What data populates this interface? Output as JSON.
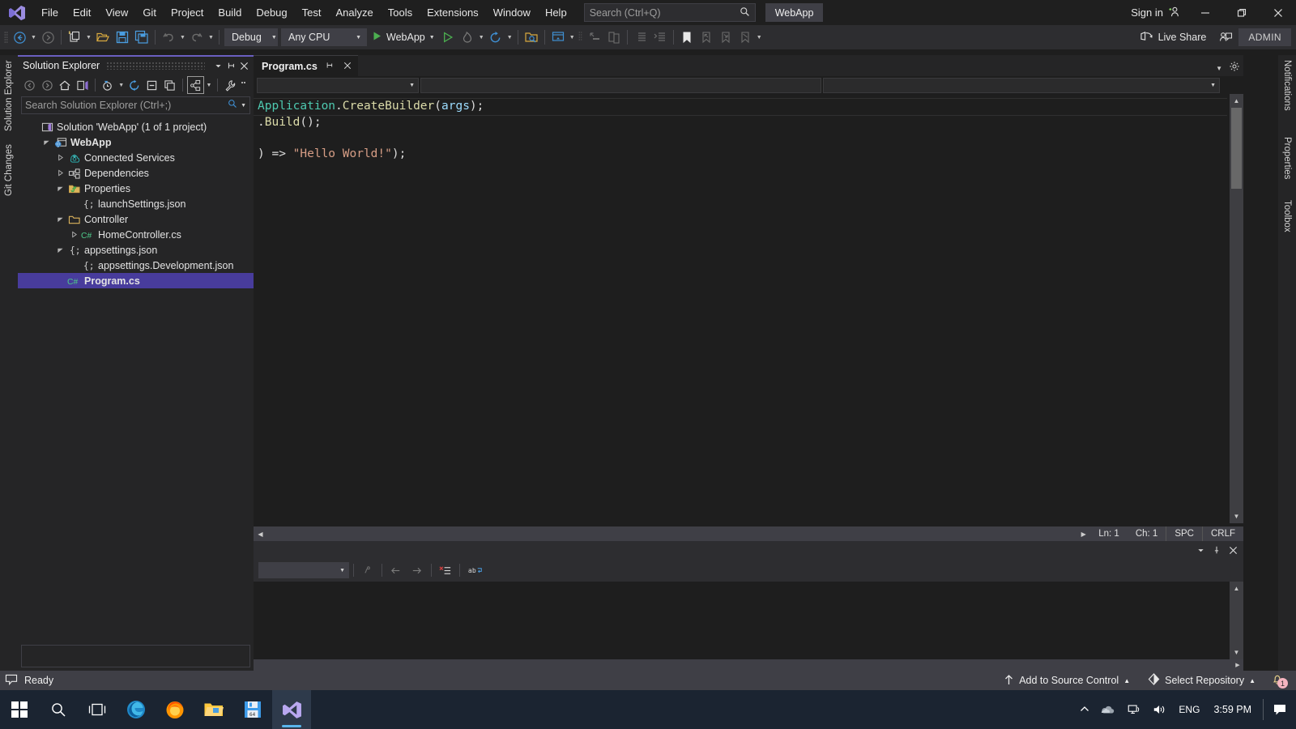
{
  "menubar": {
    "logo_icon": "visual-studio-logo",
    "items": [
      "File",
      "Edit",
      "View",
      "Git",
      "Project",
      "Build",
      "Debug",
      "Test",
      "Analyze",
      "Tools",
      "Extensions",
      "Window",
      "Help"
    ],
    "search_placeholder": "Search (Ctrl+Q)",
    "search_icon": "search-icon",
    "project_chip": "WebApp",
    "sign_in": "Sign in",
    "sign_in_icon": "add-account-icon",
    "minimize_icon": "minimize-icon",
    "maximize_icon": "restore-icon",
    "close_icon": "close-icon"
  },
  "toolbar": {
    "back_icon": "navigate-back-icon",
    "forward_icon": "navigate-forward-icon",
    "new_project_icon": "new-project-icon",
    "open_file_icon": "open-file-icon",
    "save_icon": "save-icon",
    "save_all_icon": "save-all-icon",
    "undo_icon": "undo-icon",
    "redo_icon": "redo-icon",
    "config_value": "Debug",
    "platform_value": "Any CPU",
    "run_label": "WebApp",
    "run_icon": "run-play-icon",
    "run_no_debug_icon": "start-without-debugging-icon",
    "hot_reload_icon": "hot-reload-icon",
    "restart_icon": "restart-icon",
    "find_in_files_icon": "find-in-files-icon",
    "window_layout_icon": "window-layout-icon",
    "step_icon": "step-into-icon",
    "compare_icon": "compare-files-icon",
    "indent_icon": "decrease-indent-icon",
    "outdent_icon": "increase-indent-icon",
    "bookmark_icon": "bookmark-icon",
    "prev_bookmark_icon": "previous-bookmark-icon",
    "next_bookmark_icon": "next-bookmark-icon",
    "clear_bookmark_icon": "clear-bookmarks-icon",
    "overflow_icon": "toolbar-overflow-icon",
    "live_share": "Live Share",
    "live_share_icon": "live-share-icon",
    "feedback_icon": "send-feedback-icon",
    "admin_badge": "ADMIN"
  },
  "left_dock": {
    "tabs": [
      "Solution Explorer",
      "Git Changes"
    ]
  },
  "right_dock": {
    "tabs": [
      "Notifications",
      "Properties",
      "Toolbox"
    ]
  },
  "solution_explorer": {
    "title": "Solution Explorer",
    "header_caret_icon": "chevron-down-icon",
    "header_pin_icon": "pin-icon",
    "header_close_icon": "close-icon",
    "toolbar_icons": [
      "back-icon",
      "forward-icon",
      "home-icon",
      "sync-with-active-document-icon",
      "pending-changes-filter-icon",
      "refresh-icon",
      "collapse-all-icon",
      "show-all-files-icon",
      "view-class-diagram-icon",
      "properties-wrench-icon",
      "overflow-icon"
    ],
    "search_placeholder": "Search Solution Explorer (Ctrl+;)",
    "search_icon": "search-icon",
    "tree": [
      {
        "label": "Solution 'WebApp' (1 of 1 project)",
        "icon": "solution-icon",
        "indent": 0,
        "twist": "none",
        "bold": false,
        "selected": false
      },
      {
        "label": "WebApp",
        "icon": "web-project-icon",
        "indent": 1,
        "twist": "open",
        "bold": true,
        "selected": false
      },
      {
        "label": "Connected Services",
        "icon": "connected-services-icon",
        "indent": 2,
        "twist": "closed",
        "bold": false,
        "selected": false
      },
      {
        "label": "Dependencies",
        "icon": "dependencies-icon",
        "indent": 2,
        "twist": "closed",
        "bold": false,
        "selected": false
      },
      {
        "label": "Properties",
        "icon": "properties-folder-icon",
        "indent": 2,
        "twist": "open",
        "bold": false,
        "selected": false
      },
      {
        "label": "launchSettings.json",
        "icon": "json-file-icon",
        "indent": 3,
        "twist": "none",
        "bold": false,
        "selected": false
      },
      {
        "label": "Controller",
        "icon": "folder-icon",
        "indent": 2,
        "twist": "open",
        "bold": false,
        "selected": false
      },
      {
        "label": "HomeController.cs",
        "icon": "csharp-file-icon",
        "indent": 3,
        "twist": "closed",
        "bold": false,
        "selected": false
      },
      {
        "label": "appsettings.json",
        "icon": "json-file-icon",
        "indent": 2,
        "twist": "open",
        "bold": false,
        "selected": false
      },
      {
        "label": "appsettings.Development.json",
        "icon": "json-file-icon",
        "indent": 3,
        "twist": "none",
        "bold": false,
        "selected": false
      },
      {
        "label": "Program.cs",
        "icon": "csharp-file-icon",
        "indent": 2,
        "twist": "none",
        "bold": true,
        "selected": true
      }
    ]
  },
  "editor": {
    "tab_label": "Program.cs",
    "tab_pin_icon": "pin-icon",
    "tab_close_icon": "close-icon",
    "tabstrip_caret_icon": "chevron-down-icon",
    "tabstrip_settings_icon": "gear-icon",
    "split_icon": "split-window-icon",
    "nav_type_caret": "chevron-down-icon",
    "code_lines": [
      [
        {
          "t": "Application",
          "c": "type"
        },
        {
          "t": ".",
          "c": "punct"
        },
        {
          "t": "CreateBuilder",
          "c": "method"
        },
        {
          "t": "(",
          "c": "punct"
        },
        {
          "t": "args",
          "c": "param"
        },
        {
          "t": ");",
          "c": "punct"
        }
      ],
      [
        {
          "t": ".",
          "c": "punct"
        },
        {
          "t": "Build",
          "c": "method"
        },
        {
          "t": "();",
          "c": "punct"
        }
      ],
      [],
      [
        {
          "t": ") => ",
          "c": "punct"
        },
        {
          "t": "\"Hello World!\"",
          "c": "str"
        },
        {
          "t": ");",
          "c": "punct"
        }
      ]
    ],
    "status": {
      "line": "Ln: 1",
      "char": "Ch: 1",
      "spaces": "SPC",
      "eol": "CRLF"
    }
  },
  "tool_window": {
    "caret_icon": "chevron-down-icon",
    "pin_icon": "pin-icon",
    "close_icon": "close-icon",
    "combo_value": "",
    "combo_caret_icon": "chevron-down-icon",
    "toolbar_icons": [
      "find-message-icon",
      "go-to-previous-icon",
      "go-to-next-icon",
      "clear-all-icon",
      "toggle-word-wrap-icon"
    ]
  },
  "statusbar": {
    "ready_icon": "ready-flag-icon",
    "ready_text": "Ready",
    "add_to_source_control": "Add to Source Control",
    "add_to_source_control_icon": "upload-arrow-icon",
    "add_caret_icon": "chevron-up-icon",
    "select_repository": "Select Repository",
    "select_repository_icon": "repository-icon",
    "repo_caret_icon": "chevron-up-icon",
    "notification_icon": "bell-icon",
    "notification_count": "1"
  },
  "taskbar": {
    "items": [
      {
        "name": "start-button",
        "icon": "windows-logo-icon",
        "active": false,
        "running": false
      },
      {
        "name": "search-button",
        "icon": "search-icon",
        "active": false,
        "running": false
      },
      {
        "name": "task-view-button",
        "icon": "task-view-icon",
        "active": false,
        "running": false
      },
      {
        "name": "edge-button",
        "icon": "microsoft-edge-icon",
        "active": false,
        "running": false
      },
      {
        "name": "firefox-button",
        "icon": "firefox-icon",
        "active": false,
        "running": true
      },
      {
        "name": "file-explorer-button",
        "icon": "file-explorer-icon",
        "active": false,
        "running": true
      },
      {
        "name": "dosbox-button",
        "icon": "floppy-disk-icon",
        "active": false,
        "running": true
      },
      {
        "name": "visual-studio-button",
        "icon": "visual-studio-icon",
        "active": true,
        "running": true
      }
    ],
    "tray": {
      "show_hidden_icon": "chevron-up-icon",
      "onedrive_icon": "onedrive-icon",
      "network_icon": "network-icon",
      "volume_icon": "volume-icon",
      "language": "ENG",
      "time": "3:59 PM",
      "action_center_icon": "action-center-icon"
    }
  },
  "colors": {
    "accent_purple": "#6a5fc0",
    "selection": "#483c9c",
    "chrome": "#2d2d30",
    "panel": "#252526",
    "editor_bg": "#1e1e1e",
    "status_bar": "#3f3f46",
    "taskbar": "#1b2431"
  }
}
